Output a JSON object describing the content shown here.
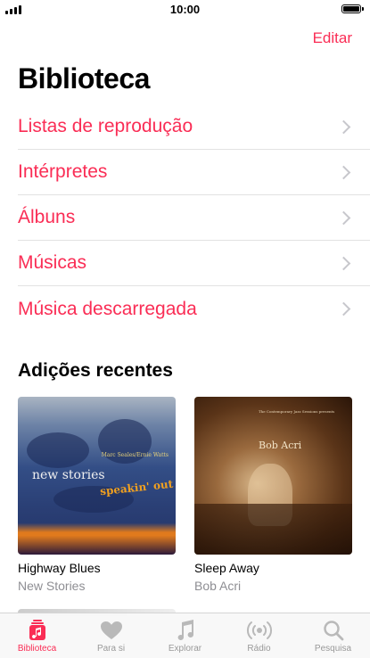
{
  "status_bar": {
    "time": "10:00"
  },
  "header": {
    "edit_label": "Editar",
    "title": "Biblioteca"
  },
  "library": {
    "items": [
      {
        "label": "Listas de reprodução"
      },
      {
        "label": "Intérpretes"
      },
      {
        "label": "Álbuns"
      },
      {
        "label": "Músicas"
      },
      {
        "label": "Música descarregada"
      }
    ]
  },
  "recent": {
    "heading": "Adições recentes",
    "albums": [
      {
        "title": "Highway Blues",
        "artist": "New Stories",
        "cover_text": "new stories",
        "cover_text2": "speakin' out",
        "cover_small": "Marc Seales/Ernie Watts"
      },
      {
        "title": "Sleep Away",
        "artist": "Bob Acri",
        "cover_text": "Bob Acri",
        "cover_small": "The Contemporary Jazz Sessions presents"
      }
    ]
  },
  "tabs": [
    {
      "label": "Biblioteca",
      "icon": "library-icon",
      "active": true
    },
    {
      "label": "Para si",
      "icon": "heart-icon",
      "active": false
    },
    {
      "label": "Explorar",
      "icon": "music-note-icon",
      "active": false
    },
    {
      "label": "Rádio",
      "icon": "radio-icon",
      "active": false
    },
    {
      "label": "Pesquisa",
      "icon": "search-icon",
      "active": false
    }
  ],
  "colors": {
    "accent": "#fa2d55",
    "inactive": "#999999"
  }
}
